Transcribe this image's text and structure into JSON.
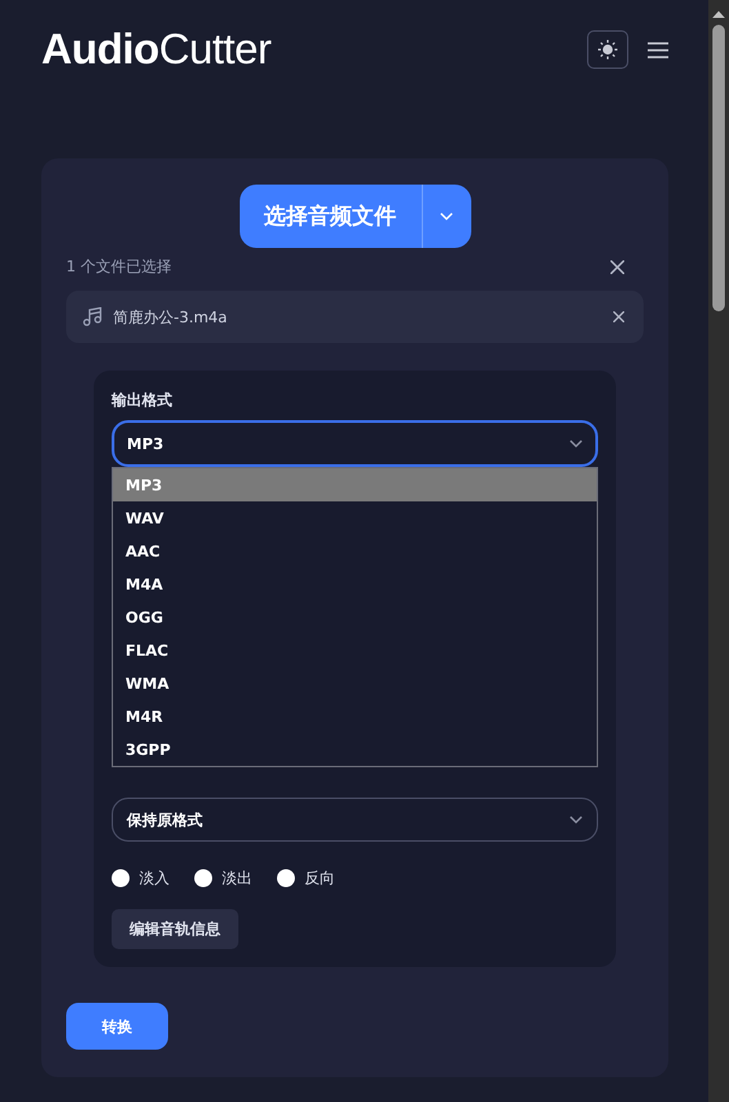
{
  "logo": {
    "bold": "Audio",
    "light": "Cutter"
  },
  "upload": {
    "button": "选择音频文件",
    "status": "1 个文件已选择"
  },
  "files": [
    {
      "name": "简鹿办公-3.m4a"
    }
  ],
  "settings": {
    "format_label": "输出格式",
    "format_value": "MP3",
    "format_options": [
      {
        "label": "MP3",
        "selected": true
      },
      {
        "label": "WAV",
        "selected": false
      },
      {
        "label": "AAC",
        "selected": false
      },
      {
        "label": "M4A",
        "selected": false
      },
      {
        "label": "OGG",
        "selected": false
      },
      {
        "label": "FLAC",
        "selected": false
      },
      {
        "label": "WMA",
        "selected": false
      },
      {
        "label": "M4R",
        "selected": false
      },
      {
        "label": "3GPP",
        "selected": false
      }
    ],
    "second_select_value": "保持原格式",
    "effects": [
      {
        "label": "淡入",
        "checked": false
      },
      {
        "label": "淡出",
        "checked": false
      },
      {
        "label": "反向",
        "checked": false
      }
    ],
    "edit_button": "编辑音轨信息"
  },
  "convert_button": "转换"
}
